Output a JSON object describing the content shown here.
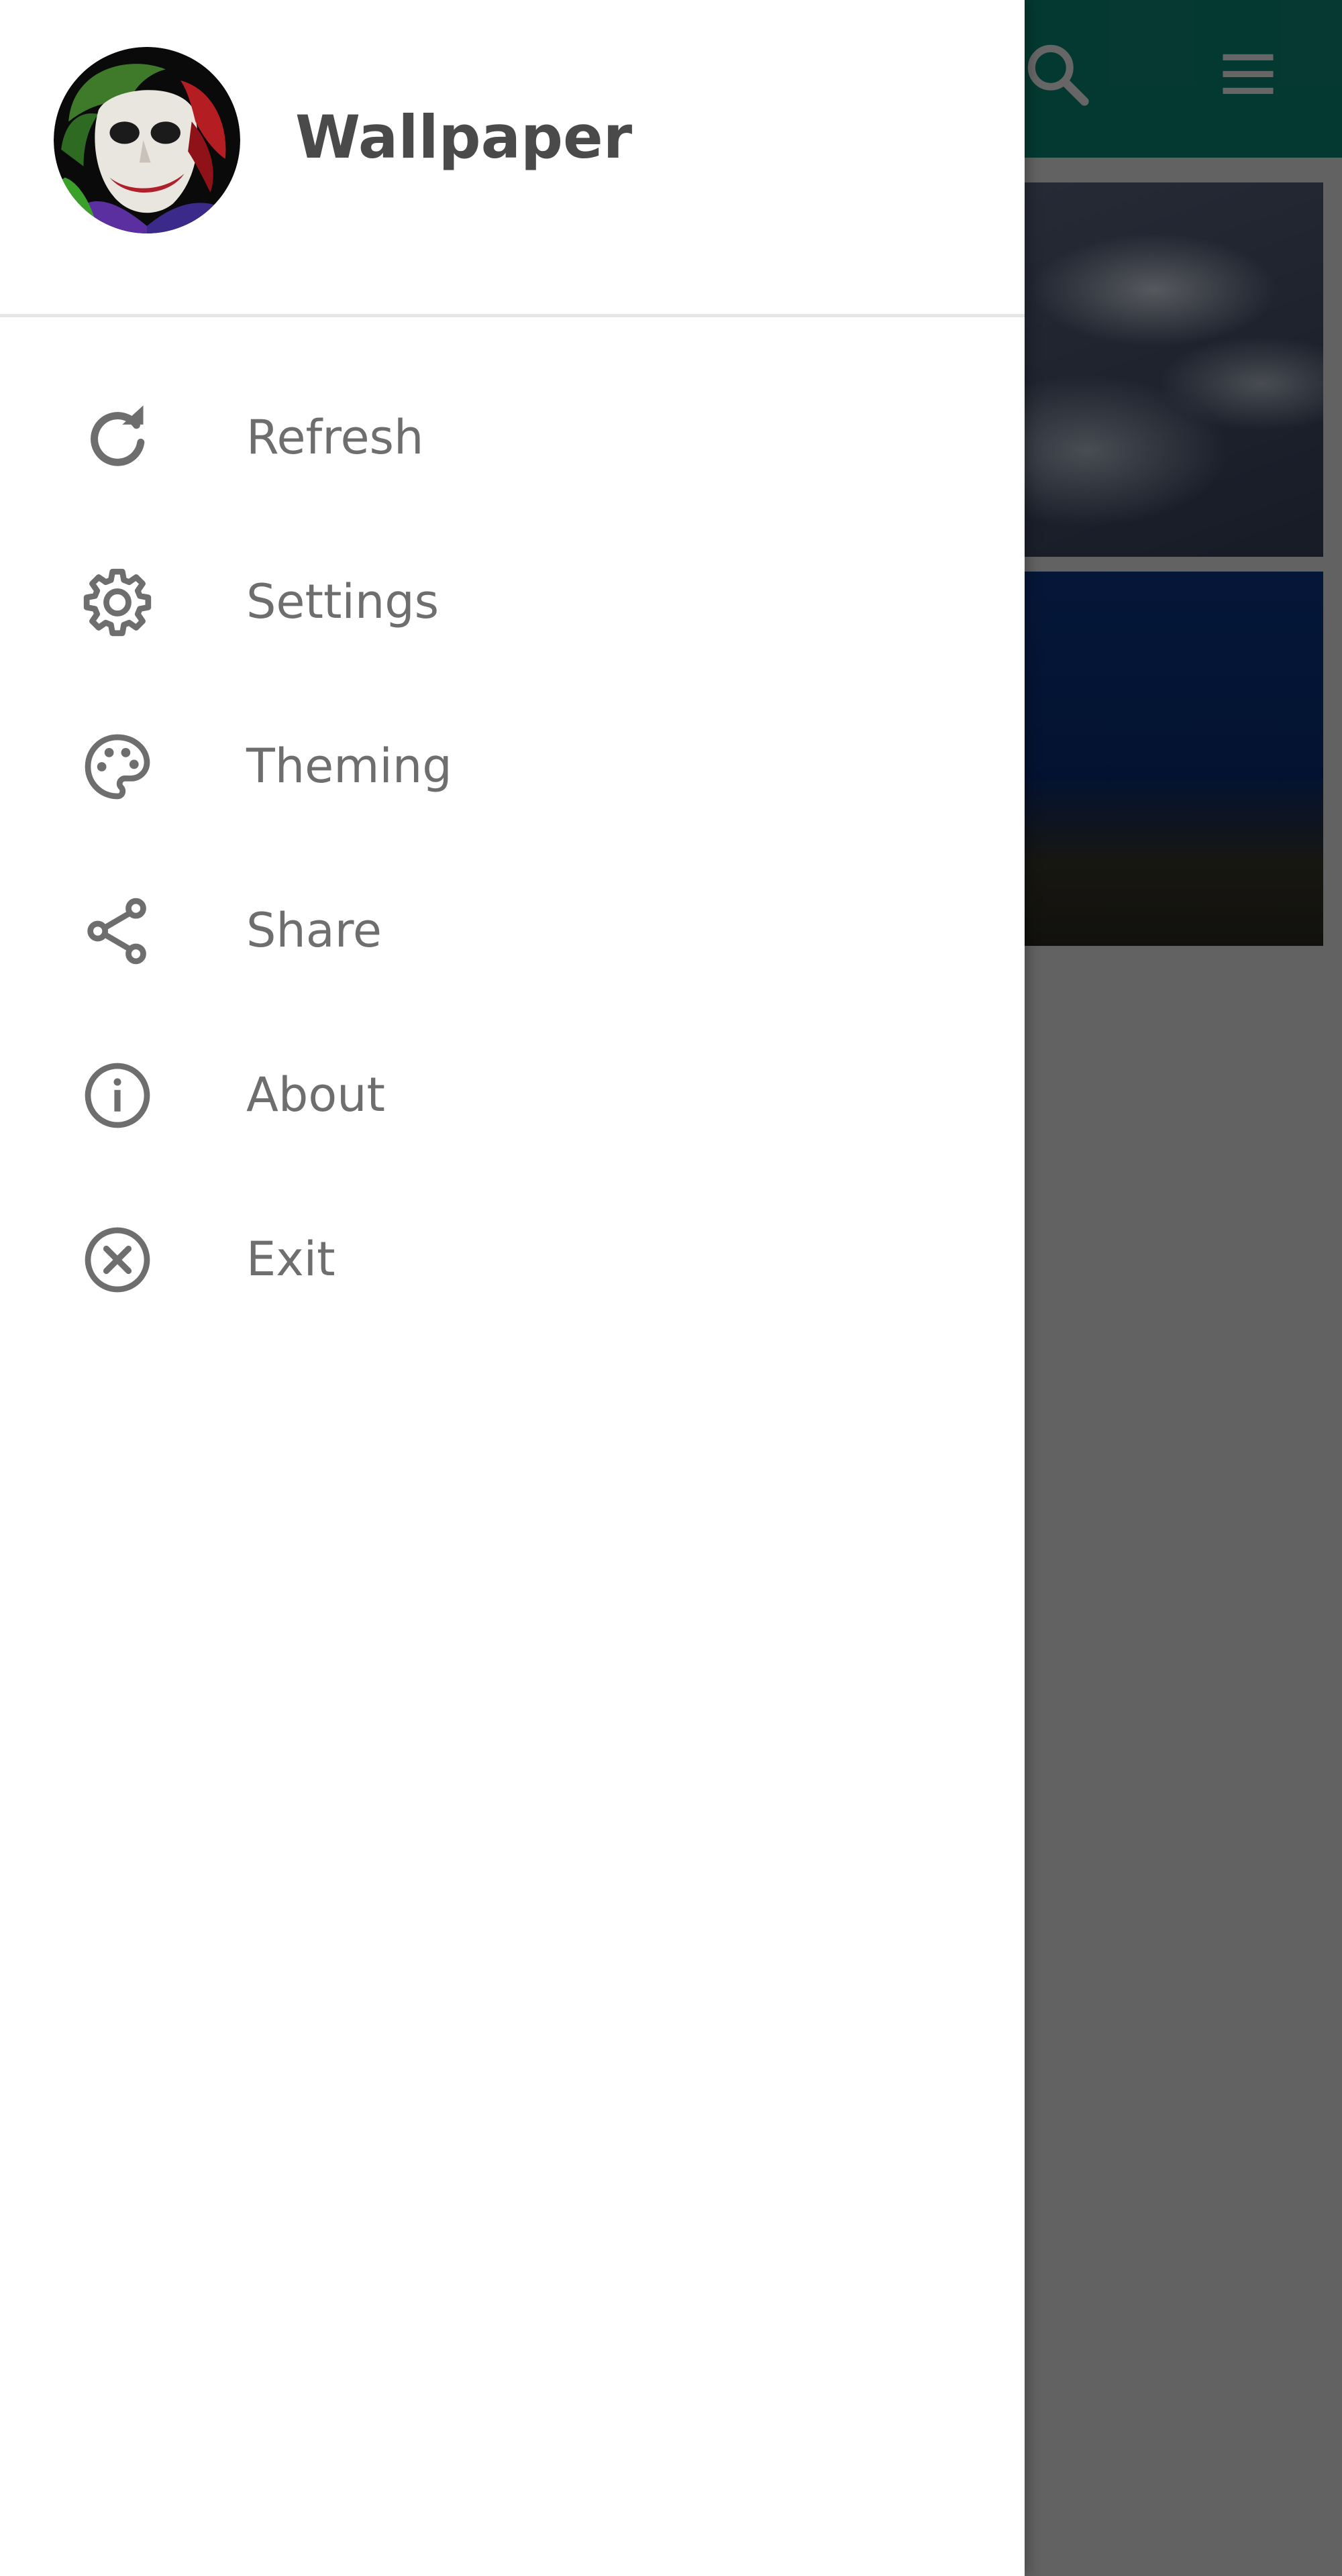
{
  "drawer": {
    "title": "Wallpaper",
    "menu": [
      {
        "label": "Refresh",
        "icon": "refresh-icon"
      },
      {
        "label": "Settings",
        "icon": "gear-icon"
      },
      {
        "label": "Theming",
        "icon": "palette-icon"
      },
      {
        "label": "Share",
        "icon": "share-icon"
      },
      {
        "label": "About",
        "icon": "info-icon"
      },
      {
        "label": "Exit",
        "icon": "close-circle-icon"
      }
    ]
  },
  "app_bar": {
    "search_icon": "search-icon",
    "menu_icon": "hamburger-menu-icon"
  },
  "colors": {
    "accent": "#0c8f7a",
    "menu_text": "#6e6e6e",
    "title_text": "#4a4a4a"
  }
}
